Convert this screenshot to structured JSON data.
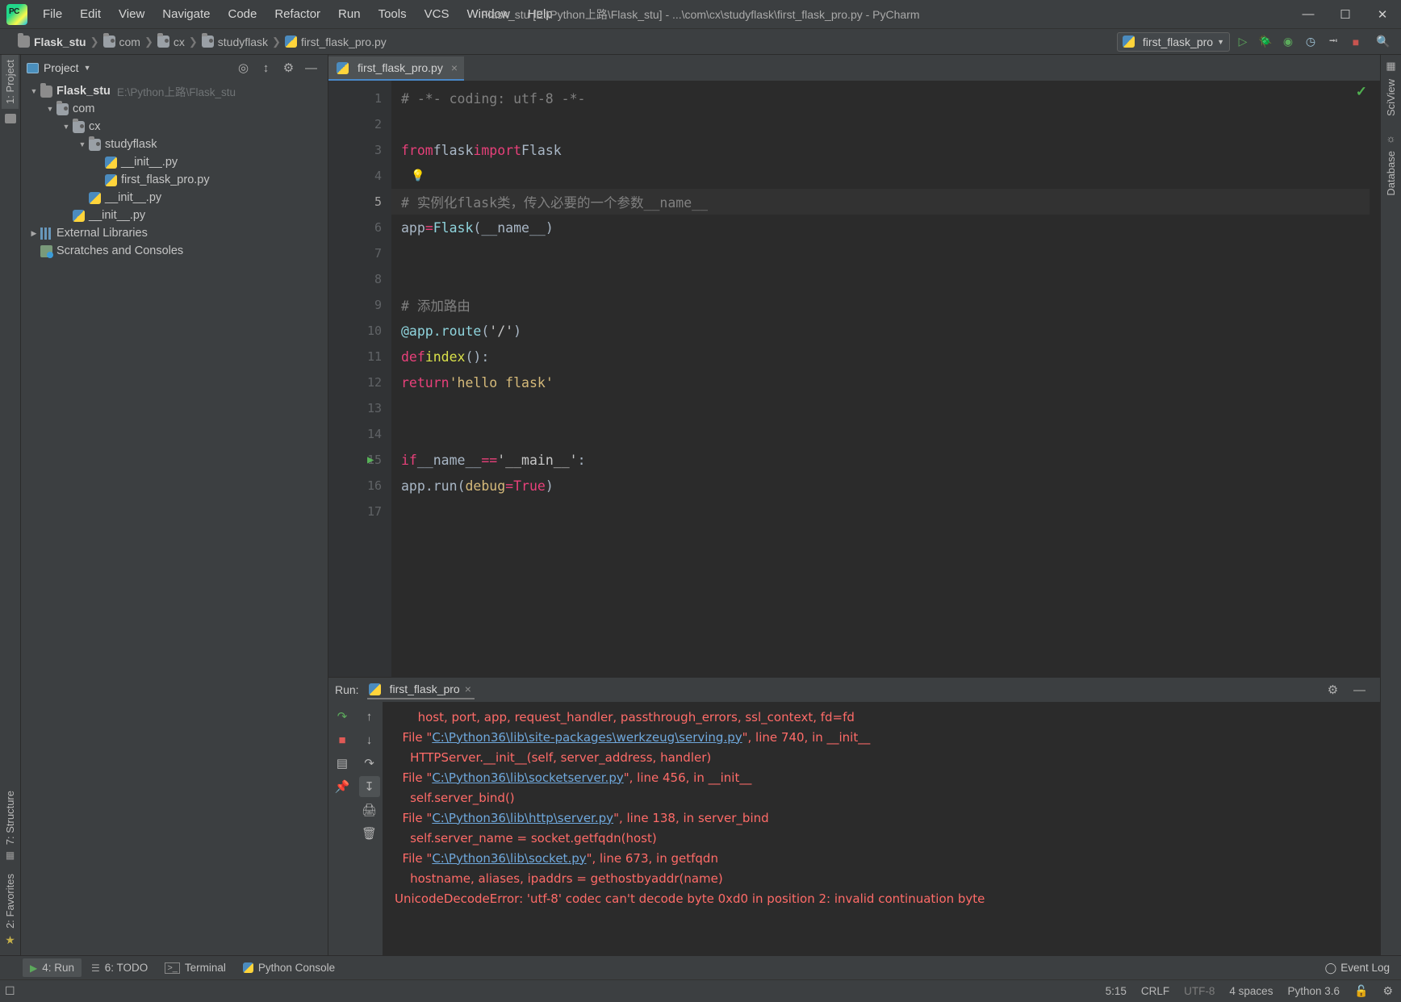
{
  "window": {
    "title": "Flask_stu [E:\\Python上路\\Flask_stu] - ...\\com\\cx\\studyflask\\first_flask_pro.py - PyCharm",
    "minimize": "—",
    "maximize": "☐",
    "close": "✕"
  },
  "menubar": [
    {
      "label": "File"
    },
    {
      "label": "Edit"
    },
    {
      "label": "View"
    },
    {
      "label": "Navigate"
    },
    {
      "label": "Code"
    },
    {
      "label": "Refactor"
    },
    {
      "label": "Run"
    },
    {
      "label": "Tools"
    },
    {
      "label": "VCS"
    },
    {
      "label": "Window"
    },
    {
      "label": "Help"
    }
  ],
  "breadcrumb": [
    {
      "label": "Flask_stu",
      "icon": "folder-icon"
    },
    {
      "label": "com",
      "icon": "package-folder-icon"
    },
    {
      "label": "cx",
      "icon": "package-folder-icon"
    },
    {
      "label": "studyflask",
      "icon": "package-folder-icon"
    },
    {
      "label": "first_flask_pro.py",
      "icon": "python-file-icon"
    }
  ],
  "toolbar": {
    "run_config": "first_flask_pro",
    "icons": [
      "run-icon",
      "debug-icon",
      "run-coverage-icon",
      "profile-icon",
      "attach-icon",
      "stop-icon",
      "search-icon"
    ]
  },
  "project_panel": {
    "title": "Project",
    "tree": [
      {
        "label": "Flask_stu",
        "path": "E:\\Python上路\\Flask_stu",
        "indent": 0,
        "arrow": "▼",
        "icon": "folder-icon",
        "bold": true
      },
      {
        "label": "com",
        "path": "",
        "indent": 1,
        "arrow": "▼",
        "icon": "package-folder-icon",
        "bold": false
      },
      {
        "label": "cx",
        "path": "",
        "indent": 2,
        "arrow": "▼",
        "icon": "package-folder-icon",
        "bold": false
      },
      {
        "label": "studyflask",
        "path": "",
        "indent": 3,
        "arrow": "▼",
        "icon": "package-folder-icon",
        "bold": false
      },
      {
        "label": "__init__.py",
        "path": "",
        "indent": 4,
        "arrow": "",
        "icon": "python-file-icon",
        "bold": false
      },
      {
        "label": "first_flask_pro.py",
        "path": "",
        "indent": 4,
        "arrow": "",
        "icon": "python-file-icon",
        "bold": false
      },
      {
        "label": "__init__.py",
        "path": "",
        "indent": 3,
        "arrow": "",
        "icon": "python-file-icon",
        "bold": false
      },
      {
        "label": "__init__.py",
        "path": "",
        "indent": 2,
        "arrow": "",
        "icon": "python-file-icon",
        "bold": false
      },
      {
        "label": "External Libraries",
        "path": "",
        "indent": 0,
        "arrow": "▶",
        "icon": "library-icon",
        "bold": false
      },
      {
        "label": "Scratches and Consoles",
        "path": "",
        "indent": 0,
        "arrow": "",
        "icon": "scratches-icon",
        "bold": false
      }
    ]
  },
  "left_strip": [
    {
      "label": "1: Project",
      "selected": true
    },
    {
      "label": "7: Structure",
      "selected": false
    },
    {
      "label": "2: Favorites",
      "selected": false
    }
  ],
  "right_strip": [
    {
      "label": "SciView"
    },
    {
      "label": "Database"
    }
  ],
  "editor": {
    "tab": "first_flask_pro.py",
    "close": "×",
    "inspection_ok": "✓",
    "lines": [
      {
        "n": "1",
        "current": false,
        "marker": "",
        "html": "<span class=\"cm\"># -*- coding: utf-8 -*-</span>"
      },
      {
        "n": "2",
        "current": false,
        "marker": "",
        "html": ""
      },
      {
        "n": "3",
        "current": false,
        "marker": "",
        "html": "<span class=\"kw2\">from</span> <span class=\"lb\">flask</span> <span class=\"kw2\">import</span> <span class=\"lb\">Flask</span>"
      },
      {
        "n": "4",
        "current": false,
        "marker": "bulb",
        "html": ""
      },
      {
        "n": "5",
        "current": true,
        "marker": "",
        "html": "<span class=\"cm\"># 实例化flask类，传入必要的一个参数__name__</span>"
      },
      {
        "n": "6",
        "current": false,
        "marker": "",
        "html": "<span class=\"lb\">app</span> <span class=\"op\">=</span> <span class=\"cls\" style=\"color:#8fd4dd\">Flask</span>(<span class=\"lb\">__name__</span>)"
      },
      {
        "n": "7",
        "current": false,
        "marker": "",
        "html": ""
      },
      {
        "n": "8",
        "current": false,
        "marker": "",
        "html": ""
      },
      {
        "n": "9",
        "current": false,
        "marker": "",
        "html": "<span class=\"cm\"># 添加路由</span>"
      },
      {
        "n": "10",
        "current": false,
        "marker": "",
        "html": "<span style=\"color:#8fd4dd\">@app.route</span>(<span class=\"str\" style=\"color:#c7c7c7\">'/'</span>)"
      },
      {
        "n": "11",
        "current": false,
        "marker": "fold-open",
        "html": "<span class=\"kw2\">def</span> <span style=\"color:#d9e04a\">index</span>():"
      },
      {
        "n": "12",
        "current": false,
        "marker": "fold-end",
        "html": "    <span class=\"kw2\">return</span> <span class=\"str\" style=\"color:#d6ba7a\">'hello flask'</span>"
      },
      {
        "n": "13",
        "current": false,
        "marker": "",
        "html": ""
      },
      {
        "n": "14",
        "current": false,
        "marker": "",
        "html": ""
      },
      {
        "n": "15",
        "current": false,
        "marker": "run",
        "html": "<span class=\"kw2\">if</span> <span class=\"lb\">__name__</span> <span class=\"op\">==</span> <span class=\"str\" style=\"color:#c7c7c7\">'__main__'</span>:"
      },
      {
        "n": "16",
        "current": false,
        "marker": "",
        "html": "    <span class=\"lb\">app</span>.<span class=\"lb\">run</span>(<span style=\"color:#d6ba7a\">debug</span><span class=\"op\">=</span><span class=\"kw2\">True</span>)"
      },
      {
        "n": "17",
        "current": false,
        "marker": "",
        "html": ""
      }
    ]
  },
  "run_panel": {
    "label": "Run:",
    "tab": "first_flask_pro",
    "tab_close": "×",
    "settings_icon": "gear-icon",
    "minimize_icon": "minimize-icon",
    "tools_left": [
      "rerun-icon",
      "stop-icon",
      "layout-icon",
      "pin-icon"
    ],
    "tools_right": [
      "up-arrow-icon",
      "down-arrow-icon",
      "soft-wrap-icon",
      "scroll-to-end-icon",
      "print-icon",
      "trash-icon"
    ],
    "console": [
      {
        "parts": [
          {
            "t": "      host, port, app, request_handler, passthrough_errors, ssl_context, fd=fd",
            "link": false
          }
        ]
      },
      {
        "parts": [
          {
            "t": "  File \"",
            "link": false
          },
          {
            "t": "C:\\Python36\\lib\\site-packages\\werkzeug\\serving.py",
            "link": true
          },
          {
            "t": "\", line 740, in __init__",
            "link": false
          }
        ]
      },
      {
        "parts": [
          {
            "t": "    HTTPServer.__init__(self, server_address, handler)",
            "link": false
          }
        ]
      },
      {
        "parts": [
          {
            "t": "  File \"",
            "link": false
          },
          {
            "t": "C:\\Python36\\lib\\socketserver.py",
            "link": true
          },
          {
            "t": "\", line 456, in __init__",
            "link": false
          }
        ]
      },
      {
        "parts": [
          {
            "t": "    self.server_bind()",
            "link": false
          }
        ]
      },
      {
        "parts": [
          {
            "t": "  File \"",
            "link": false
          },
          {
            "t": "C:\\Python36\\lib\\http\\server.py",
            "link": true
          },
          {
            "t": "\", line 138, in server_bind",
            "link": false
          }
        ]
      },
      {
        "parts": [
          {
            "t": "    self.server_name = socket.getfqdn(host)",
            "link": false
          }
        ]
      },
      {
        "parts": [
          {
            "t": "  File \"",
            "link": false
          },
          {
            "t": "C:\\Python36\\lib\\socket.py",
            "link": true
          },
          {
            "t": "\", line 673, in getfqdn",
            "link": false
          }
        ]
      },
      {
        "parts": [
          {
            "t": "    hostname, aliases, ipaddrs = gethostbyaddr(name)",
            "link": false
          }
        ]
      },
      {
        "parts": [
          {
            "t": "UnicodeDecodeError: 'utf-8' codec can't decode byte 0xd0 in position 2: invalid continuation byte",
            "link": false
          }
        ]
      }
    ]
  },
  "bottom_tabs": [
    {
      "label": "4: Run",
      "icon": "run-icon",
      "selected": true
    },
    {
      "label": "6: TODO",
      "icon": "todo-icon",
      "selected": false
    },
    {
      "label": "Terminal",
      "icon": "terminal-icon",
      "selected": false
    },
    {
      "label": "Python Console",
      "icon": "python-icon",
      "selected": false
    }
  ],
  "event_log": {
    "label": "Event Log",
    "icon": "bell-icon"
  },
  "statusbar": {
    "caret": "5:15",
    "line_separator": "CRLF",
    "encoding": "UTF-8",
    "indent": "4 spaces",
    "interpreter": "Python 3.6",
    "lock_icon": "unlock-icon",
    "inspector_icon": "inspector-icon"
  },
  "colors": {
    "accent_blue": "#4a88c7",
    "error_red": "#ff6b68",
    "link_blue": "#6fa8dc",
    "keyword": "#e8407a",
    "comment": "#808080",
    "panel_bg": "#3c3f41",
    "editor_bg": "#2b2b2b"
  }
}
